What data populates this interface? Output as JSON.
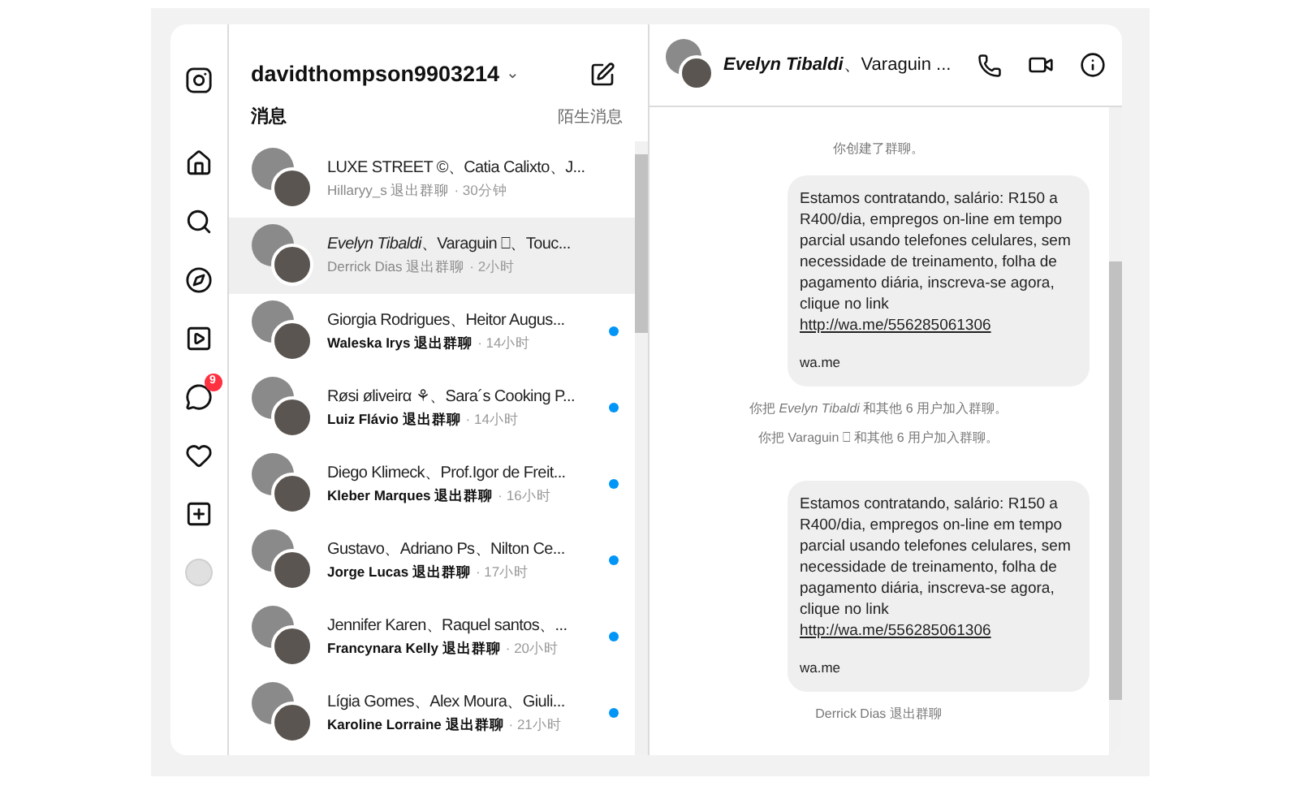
{
  "nav": {
    "badge": "9"
  },
  "inbox": {
    "account": "davidthompson9903214",
    "caret": "⌄",
    "heading": "消息",
    "requests": "陌生消息"
  },
  "conversations": [
    {
      "title": "LUXE STREET ©、Catia Calixto、J...",
      "sender": "Hillaryy_s",
      "action": "退出群聊",
      "time": "· 30分钟",
      "unread": false,
      "selected": false
    },
    {
      "title": "*Evelyn Tibaldi*、Varaguin ⎕、Touc...",
      "sender": "Derrick Dias",
      "action": "退出群聊",
      "time": "· 2小时",
      "unread": false,
      "selected": true
    },
    {
      "title": "Giorgia Rodrigues、Heitor Augus...",
      "sender": "Waleska Irys",
      "action": "退出群聊",
      "time": "· 14小时",
      "unread": true,
      "selected": false
    },
    {
      "title": "Røsi øliveirα ⚘、Sara´s Cooking P...",
      "sender": "Luiz Flávio",
      "action": "退出群聊",
      "time": "· 14小时",
      "unread": true,
      "selected": false
    },
    {
      "title": "Diego Klimeck、Prof.Igor de Freit...",
      "sender": "Kleber Marques",
      "action": "退出群聊",
      "time": "· 16小时",
      "unread": true,
      "selected": false
    },
    {
      "title": "Gustavo、Adriano Ps、Nilton Ce...",
      "sender": "Jorge Lucas",
      "action": "退出群聊",
      "time": "· 17小时",
      "unread": true,
      "selected": false
    },
    {
      "title": "Jennifer Karen、Raquel santos、...",
      "sender": "Francynara Kelly",
      "action": "退出群聊",
      "time": "· 20小时",
      "unread": true,
      "selected": false
    },
    {
      "title": "Lígia Gomes、Alex Moura、Giuli...",
      "sender": "Karoline Lorraine",
      "action": "退出群聊",
      "time": "· 21小时",
      "unread": true,
      "selected": false
    }
  ],
  "chat": {
    "title": "*Evelyn Tibaldi*、Varaguin ...",
    "messages": [
      {
        "kind": "system",
        "text": "你创建了群聊。"
      },
      {
        "kind": "bubble",
        "text": "Estamos contratando, salário: R150 a R400/dia, empregos on-line em tempo parcial usando telefones celulares, sem necessidade de treinamento, folha de pagamento diária, inscreva-se agora, clique no link",
        "link": "http://wa.me/556285061306",
        "preview": "wa.me"
      },
      {
        "kind": "system",
        "text": "你把 *Evelyn Tibaldi* 和其他 6 用户加入群聊。"
      },
      {
        "kind": "system",
        "text": "你把 Varaguin ⎕ 和其他 6 用户加入群聊。"
      },
      {
        "kind": "bubble",
        "text": "Estamos contratando, salário: R150 a R400/dia, empregos on-line em tempo parcial usando telefones celulares, sem necessidade de treinamento, folha de pagamento diária, inscreva-se agora, clique no link",
        "link": "http://wa.me/556285061306",
        "preview": "wa.me"
      },
      {
        "kind": "system",
        "text": "Derrick Dias 退出群聊"
      }
    ]
  }
}
